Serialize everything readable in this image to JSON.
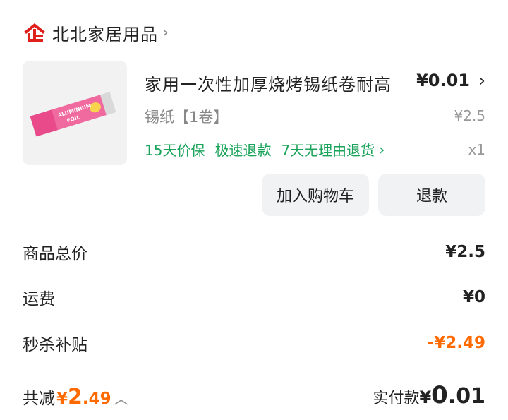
{
  "shop": {
    "name": "北北家居用品",
    "chevron": "›",
    "logo_color": "#e0201a"
  },
  "product": {
    "title": "家用一次性加厚烧烤锡纸卷耐高",
    "price": "¥0.01",
    "price_chevron": "›",
    "spec": "锡纸【1卷】",
    "original_price": "¥2.5",
    "tags": [
      "15天价保",
      "极速退款",
      "7天无理由退货"
    ],
    "tags_chevron": "›",
    "quantity": "x1",
    "image_label": "ALUMINIUM FOIL",
    "tag_color": "#1aa35a"
  },
  "actions": {
    "add_to_cart": "加入购物车",
    "refund": "退款"
  },
  "summary": {
    "items_total_label": "商品总价",
    "items_total_value": "¥2.5",
    "shipping_label": "运费",
    "shipping_value": "¥0",
    "subsidy_label": "秒杀补贴",
    "subsidy_value": "-¥2.49",
    "accent_color": "#ff6a00"
  },
  "footer": {
    "saved_label": "共减",
    "saved_currency": "¥",
    "saved_int": "2",
    "saved_dec": ".49",
    "saved_toggle": "︿",
    "paid_label": "实付款",
    "paid_currency": "¥",
    "paid_int": "0",
    "paid_dec": ".01"
  }
}
